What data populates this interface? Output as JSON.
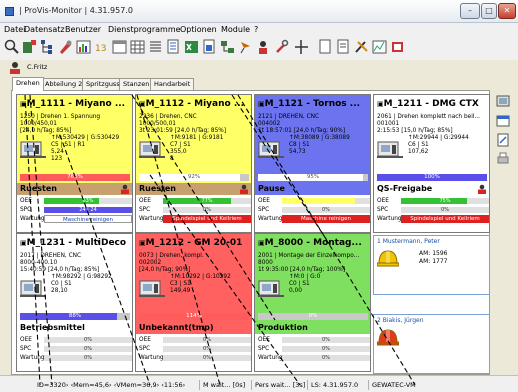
{
  "window": {
    "title": "| ProVis-Monitor | 4.31.957.0",
    "btn_min": "–",
    "btn_max": "□",
    "btn_close": "✕"
  },
  "menu": [
    "Datei",
    "Datensatz",
    "Benutzer",
    "Dienstprogramme",
    "Optionen",
    "Module",
    "?"
  ],
  "user": {
    "name": "C.Fritz"
  },
  "tabs": [
    "Drehen",
    "Abteilung 2",
    "Spritzguss",
    "Stanzen",
    "Handarbeit"
  ],
  "colors": {
    "yellow": "#ffff66",
    "blue": "#6b73ee",
    "green": "#7ee05e",
    "red": "#ff6060",
    "bar_red": "#ff5b5b",
    "bar_green": "#34c234",
    "bar_blue": "#5a4fe8",
    "ruesten": "#c8a070",
    "qs": "#ffffff",
    "wart_red": "#dd2020"
  },
  "cards": [
    {
      "title": "M_1111 - Miyano ...",
      "hdr_color": "#ffff66",
      "body_color": "#ffff66",
      "lines": [
        "1250 | Drehen 1. Spannung",
        "1000/450,01",
        "[24,0 h/Tag; 85%]",
        "↑M:530429 | G:530429",
        "C5 | S1 | R1",
        "5,24",
        "123"
      ],
      "bar_pct": 100,
      "bar_label": "768%",
      "bar_color": "#ff5b5b",
      "status": "Ruesten",
      "status_color": "#c8a070",
      "oee_pct": 63,
      "oee_label": "63%",
      "oee_color": "#34c234",
      "spc_label": "24 | 24",
      "spc_pct": 100,
      "spc_color": "#5a4fe8",
      "wart_label": "Maschine reinigen",
      "wart_red": false,
      "wart_hi": true
    },
    {
      "title": "M_1112 - Miyano ...",
      "hdr_color": "#ffff66",
      "body_color": "#ffff66",
      "lines": [
        "2236 | Drehen, CNC",
        "1000/500,01",
        "3t 23:01:59 [24,0 h/Tag; 85%]",
        "↑M:9181 | G:9181",
        "C7 | S1",
        "355,0",
        "8"
      ],
      "bar_pct": 92,
      "bar_label": "92%",
      "bar_color": "#ffffff",
      "status": "Ruesten",
      "status_color": "#c8a070",
      "oee_pct": 77,
      "oee_label": "77%",
      "oee_color": "#34c234",
      "spc_label": "0%",
      "spc_pct": 0,
      "spc_color": "#5a4fe8",
      "wart_label": "Spindelspiel und Keilriem",
      "wart_red": true
    },
    {
      "title": "M_1121 - Tornos ...",
      "hdr_color": "#6b73ee",
      "body_color": "#6b73ee",
      "lines": [
        "2121 | DREHEN, CNC",
        "004002",
        "1t 18:57:01 [24,0 h/Tag; 90%]",
        "↑M:38089 | G:38089",
        "C8 | S1",
        "54,73",
        ""
      ],
      "bar_pct": 95,
      "bar_label": "95%",
      "bar_color": "#ffffff",
      "status": "Pause",
      "status_color": "#6b73ee",
      "oee_pct": 83,
      "oee_label": "",
      "oee_color": "#ffff66",
      "spc_label": "0%",
      "spc_pct": 0,
      "spc_color": "#5a4fe8",
      "wart_label": "Maschine reinigen",
      "wart_red": true
    },
    {
      "title": "M_1211 - DMG CTX",
      "hdr_color": "#ffffff",
      "body_color": "#ffffff",
      "lines": [
        "2061 | Drehen komplett nach beil...",
        "001001",
        "2:15:53 [15,0 h/Tag; 85%]",
        "↑M:29944 | G:29944",
        "C6 | S1",
        "107,62",
        ""
      ],
      "bar_pct": 100,
      "bar_label": "100%",
      "bar_color": "#5a4fe8",
      "status": "QS-Freigabe",
      "status_color": "#ffffff",
      "oee_pct": 75,
      "oee_label": "75%",
      "oee_color": "#34c234",
      "spc_label": "0%",
      "spc_pct": 0,
      "spc_color": "#5a4fe8",
      "wart_label": "Spindelspiel und Keilriem",
      "wart_red": true
    },
    {
      "title": "M_1231 - MultiDeco",
      "hdr_color": "#ffffff",
      "body_color": "#ffffff",
      "lines": [
        "2017 | DREHEN, CNC",
        "8000-400.10",
        "15:40:59 [24,0 h/Tag; 85%]",
        "↑M:98292 | G:98292",
        "C0 | S1",
        "28,10",
        ""
      ],
      "bar_pct": 88,
      "bar_label": "88%",
      "bar_color": "#5a4fe8",
      "status": "Betriebsmittel",
      "status_color": "#ffffff",
      "oee_pct": 0,
      "oee_label": "0%",
      "oee_color": "#34c234",
      "spc_label": "0%",
      "spc_pct": 0,
      "spc_color": "#5a4fe8",
      "wart_label": "0%",
      "wart_red": false,
      "wart_hi": false
    },
    {
      "title": "M_1212 - GM 20-01",
      "hdr_color": "#ff6060",
      "body_color": "#ff6060",
      "lines": [
        "0073 | Drehen, kompl.",
        "002002",
        "[24,0 h/Tag; 90%]",
        "↑M:10292 | G:10292",
        "C3 | S1",
        "149,49",
        ""
      ],
      "bar_pct": 100,
      "bar_label": "114%",
      "bar_color": "#ff5b5b",
      "status": "Unbekannt(tmp)",
      "status_color": "#ff6060",
      "oee_pct": 0,
      "oee_label": "0%",
      "oee_color": "#34c234",
      "spc_label": "0%",
      "spc_pct": 0,
      "spc_color": "#5a4fe8",
      "wart_label": "0%",
      "wart_red": false,
      "wart_hi": false
    },
    {
      "title": "M_8000 - Montag...",
      "hdr_color": "#7ee05e",
      "body_color": "#7ee05e",
      "lines": [
        "2001 | Montage der Einzelkompo...",
        "8000",
        "1t 9:35:00 [24,0 h/Tag; 100%]",
        "↑M:0 | G:0",
        "C0 | S1",
        "0,00",
        ""
      ],
      "bar_pct": 0,
      "bar_label": "0%",
      "bar_color": "#5a4fe8",
      "status": "Produktion",
      "status_color": "#7ee05e",
      "oee_pct": 0,
      "oee_label": "0%",
      "oee_color": "#34c234",
      "spc_label": "0%",
      "spc_pct": 0,
      "spc_color": "#5a4fe8",
      "wart_label": "0%",
      "wart_red": false,
      "wart_hi": false
    }
  ],
  "labels": {
    "oee": "OEE",
    "spc": "SPC",
    "wart": "Wartung"
  },
  "persons": [
    {
      "name": "1 Mustermann, Peter",
      "am1": "AM: 1596",
      "am2": "AM: 1777",
      "helmet": "#f2c400"
    },
    {
      "name": "2 Biakis, Jürgen",
      "am1": "",
      "am2": "",
      "helmet": "#e53a1a"
    }
  ],
  "statusbar": [
    "ID=3320› ‹Mem=45,6› ‹VMem=36,9› ‹11:56›",
    "M wait... [0s]",
    "Pers wait... [3s]",
    "LS: 4.31.957.0",
    "GEWATEC-VM"
  ]
}
